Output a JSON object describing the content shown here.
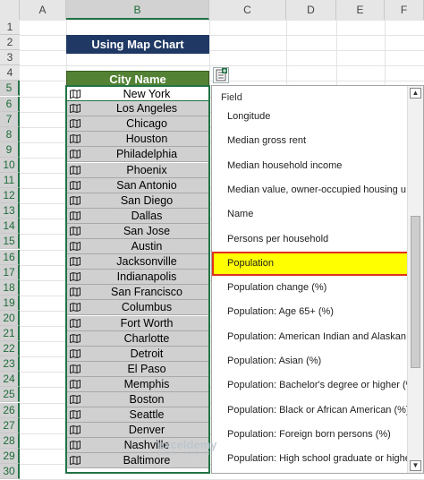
{
  "columns": [
    "A",
    "B",
    "C",
    "D",
    "E",
    "F"
  ],
  "rows": [
    "1",
    "2",
    "3",
    "4",
    "5",
    "6",
    "7",
    "8",
    "9",
    "10",
    "11",
    "12",
    "13",
    "14",
    "15",
    "16",
    "17",
    "18",
    "19",
    "20",
    "21",
    "22",
    "23",
    "24",
    "25",
    "26",
    "27",
    "28",
    "29",
    "30"
  ],
  "title": "Using Map Chart",
  "city_header": "City Name",
  "cities": [
    "New York",
    "Los Angeles",
    "Chicago",
    "Houston",
    "Philadelphia",
    "Phoenix",
    "San Antonio",
    "San Diego",
    "Dallas",
    "San Jose",
    "Austin",
    "Jacksonville",
    "Indianapolis",
    "San Francisco",
    "Columbus",
    "Fort Worth",
    "Charlotte",
    "Detroit",
    "El Paso",
    "Memphis",
    "Boston",
    "Seattle",
    "Denver",
    "Nashville",
    "Baltimore"
  ],
  "city_icon": "map-icon",
  "field_panel": {
    "header": "Field",
    "items": [
      "Longitude",
      "Median gross rent",
      "Median household income",
      "Median value, owner-occupied housing u...",
      "Name",
      "Persons per household",
      "Population",
      "Population change (%)",
      "Population: Age 65+ (%)",
      "Population: American Indian and Alaskan...",
      "Population: Asian (%)",
      "Population: Bachelor's degree or higher (%)",
      "Population: Black or African American (%)",
      "Population: Foreign born persons (%)",
      "Population: High school graduate or higher..."
    ],
    "selected": "Population"
  },
  "watermark": {
    "name": "exceldemy",
    "tagline": "EXCEL · DATA · BI"
  },
  "colors": {
    "title_bg": "#1f3864",
    "header_bg": "#548235",
    "highlight": "#ffff00",
    "highlight_border": "#e0301e"
  }
}
